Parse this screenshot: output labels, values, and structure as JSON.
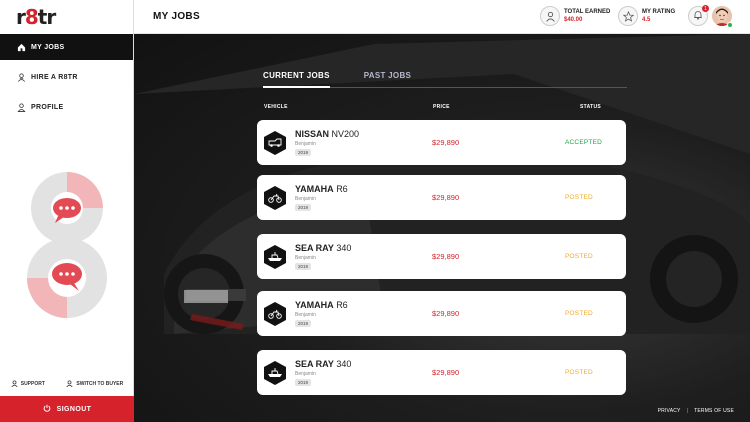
{
  "logo": {
    "pre": "r",
    "mid": "8",
    "post": "tr"
  },
  "sidebar": {
    "items": [
      {
        "label": "MY JOBS",
        "icon": "home-icon"
      },
      {
        "label": "HIRE A R8TR",
        "icon": "hire-icon"
      },
      {
        "label": "PROFILE",
        "icon": "user-icon"
      }
    ],
    "support": "SUPPORT",
    "switch": "SWITCH TO BUYER",
    "signout": "SIGNOUT"
  },
  "header": {
    "title": "MY JOBS",
    "total_earned_label": "TOTAL EARNED",
    "total_earned_value": "$40.00",
    "rating_label": "MY RATING",
    "rating_value": "4.5",
    "notif_count": "1"
  },
  "tabs": {
    "current": "CURRENT JOBS",
    "past": "PAST JOBS"
  },
  "columns": {
    "vehicle": "VEHICLE",
    "price": "PRICE",
    "status": "STATUS"
  },
  "jobs": [
    {
      "make": "NISSAN",
      "model": "NV200",
      "owner": "Benjamin",
      "year": "2019",
      "price": "$29,890",
      "status": "ACCEPTED",
      "icon": "van-icon"
    },
    {
      "make": "YAMAHA",
      "model": "R6",
      "owner": "Benjamin",
      "year": "2019",
      "price": "$29,890",
      "status": "POSTED",
      "icon": "motorcycle-icon"
    },
    {
      "make": "SEA RAY",
      "model": "340",
      "owner": "Benjamin",
      "year": "2019",
      "price": "$29,890",
      "status": "POSTED",
      "icon": "boat-icon"
    },
    {
      "make": "YAMAHA",
      "model": "R6",
      "owner": "Benjamin",
      "year": "2019",
      "price": "$29,890",
      "status": "POSTED",
      "icon": "motorcycle-icon"
    },
    {
      "make": "SEA RAY",
      "model": "340",
      "owner": "Benjamin",
      "year": "2019",
      "price": "$29,890",
      "status": "POSTED",
      "icon": "boat-icon"
    }
  ],
  "footer": {
    "privacy": "PRIVACY",
    "sep": "|",
    "terms": "TERMS OF USE"
  },
  "colors": {
    "brand": "#d6222a",
    "accepted": "#21a24a",
    "posted": "#f0ad2c"
  }
}
